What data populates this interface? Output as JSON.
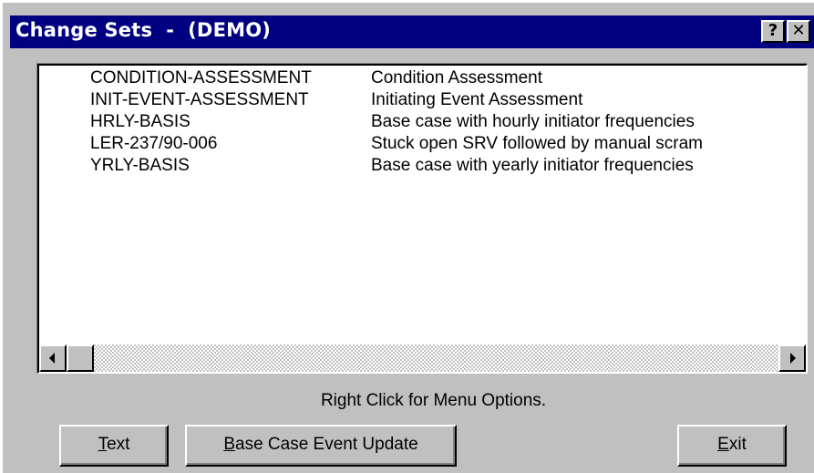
{
  "window": {
    "title": "Change Sets  -  (DEMO)",
    "help_glyph": "?",
    "close_glyph": "✕"
  },
  "listbox": {
    "rows": [
      {
        "name": "CONDITION-ASSESSMENT",
        "description": "Condition Assessment"
      },
      {
        "name": "INIT-EVENT-ASSESSMENT",
        "description": "Initiating Event Assessment"
      },
      {
        "name": "HRLY-BASIS",
        "description": "Base case with hourly initiator frequencies"
      },
      {
        "name": "LER-237/90-006",
        "description": "Stuck open SRV followed by manual scram"
      },
      {
        "name": "YRLY-BASIS",
        "description": "Base case with yearly initiator frequencies"
      }
    ]
  },
  "hint": "Right Click for Menu Options.",
  "buttons": {
    "text": {
      "accel": "T",
      "rest": "ext"
    },
    "base_case": {
      "accel": "B",
      "rest": "ase Case Event Update"
    },
    "exit": {
      "accel": "E",
      "rest": "xit"
    }
  },
  "icons": {
    "scroll_left": "scroll-left-arrow-icon",
    "scroll_right": "scroll-right-arrow-icon"
  }
}
